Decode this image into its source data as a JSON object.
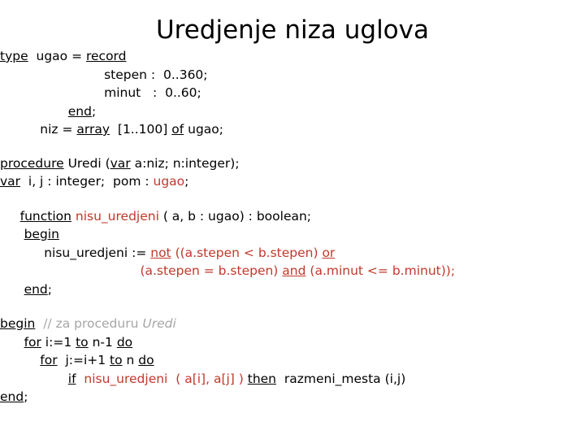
{
  "slide": {
    "title": "Uredjenje niza uglova",
    "background_color": "#FFFFFF",
    "text_color": "#000000",
    "keyword_color": "#000000",
    "accent_color": "#C0392B",
    "comment_color": "#A6A6A6"
  },
  "code": {
    "type_block": {
      "line1": {
        "kw_type": "type",
        "mid": "  ugao = ",
        "kw_record": "record"
      },
      "line2": "                          stepen :  0..360;",
      "line3": "                          minut   :  0..60;",
      "line4": {
        "indent": "                 ",
        "kw_end": "end",
        "tail": ";"
      },
      "line5": {
        "indent": "          ",
        "pre": "niz = ",
        "kw_array": "array",
        "mid": "  [1..100] ",
        "kw_of": "of",
        "tail": " ugao;"
      }
    },
    "procedure_header": {
      "line1": {
        "kw_procedure": "procedure",
        "mid": " Uredi (",
        "kw_var": "var",
        "tail": " a:niz; n:integer);"
      },
      "line2": {
        "kw_var": "var",
        "mid": "  i, j : integer;  pom : ",
        "type_ref": "ugao",
        "tail": ";"
      }
    },
    "function_block": {
      "line1": {
        "indent": "     ",
        "kw_function": "function",
        "name": " nisu_uredjeni",
        "tail": " ( a, b : ugao) : boolean;"
      },
      "line2": {
        "indent": "      ",
        "kw_begin": "begin"
      },
      "line3": {
        "indent": "           ",
        "assign": "nisu_uredjeni := ",
        "kw_not": "not",
        "expr": " ((a.stepen < b.stepen) ",
        "kw_or": "or"
      },
      "line4": {
        "indent": "                                   ",
        "expr1": "(a.stepen = b.stepen) ",
        "kw_and": "and",
        "expr2": " (a.minut <= b.minut));"
      },
      "line5": {
        "indent": "      ",
        "kw_end": "end",
        "tail": ";"
      }
    },
    "main_block": {
      "line1": {
        "kw_begin": "begin",
        "comment_plain": "  // za proceduru ",
        "comment_italic": "Uredi"
      },
      "line2": {
        "indent": "      ",
        "kw_for": "for",
        "mid1": " i:=1 ",
        "kw_to": "to",
        "mid2": " n-1 ",
        "kw_do": "do"
      },
      "line3": {
        "indent": "          ",
        "kw_for": "for",
        "mid1": "  j:=i+1 ",
        "kw_to": "to",
        "mid2": " n ",
        "kw_do": "do"
      },
      "line4": {
        "indent": "                 ",
        "kw_if": "if",
        "call": "  nisu_uredjeni  ( a[i], a[j] ) ",
        "kw_then": "then",
        "tail": "  razmeni_mesta (i,j)"
      },
      "line5": {
        "kw_end": "end",
        "tail": ";"
      }
    }
  }
}
